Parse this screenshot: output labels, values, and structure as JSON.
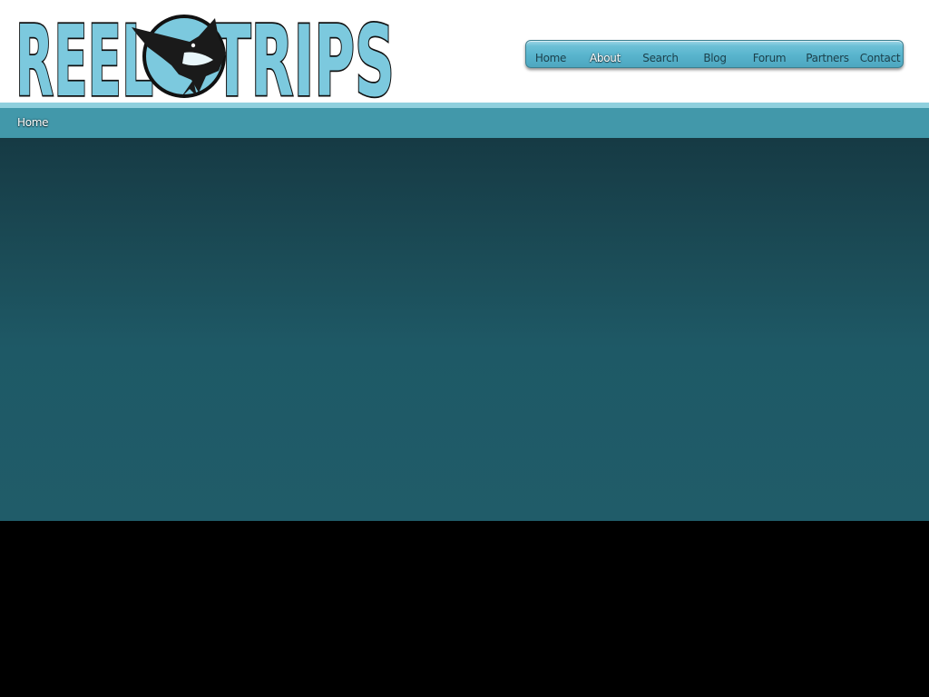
{
  "logo": {
    "text_left": "REEL",
    "text_right": "TRIPS"
  },
  "nav": {
    "items": [
      {
        "label": "Home",
        "active": false
      },
      {
        "label": "About",
        "active": true
      },
      {
        "label": "Search",
        "active": false
      },
      {
        "label": "Blog",
        "active": false
      },
      {
        "label": "Forum",
        "active": false
      },
      {
        "label": "Partners",
        "active": false
      },
      {
        "label": "Contact",
        "active": false
      }
    ]
  },
  "breadcrumb": {
    "label": "Home"
  },
  "colors": {
    "logo_fill": "#7cc9de",
    "logo_outline": "#111111",
    "nav_gradient_top": "#9fd6e6",
    "nav_gradient_bottom": "#4ea7bf",
    "stripe": "#8fd0de",
    "breadcrumb_bar": "#4298aa",
    "content_top": "#163a44",
    "content_bottom": "#205c69",
    "footer": "#000000"
  },
  "icons": {
    "logo_emblem": "swordfish-icon"
  }
}
